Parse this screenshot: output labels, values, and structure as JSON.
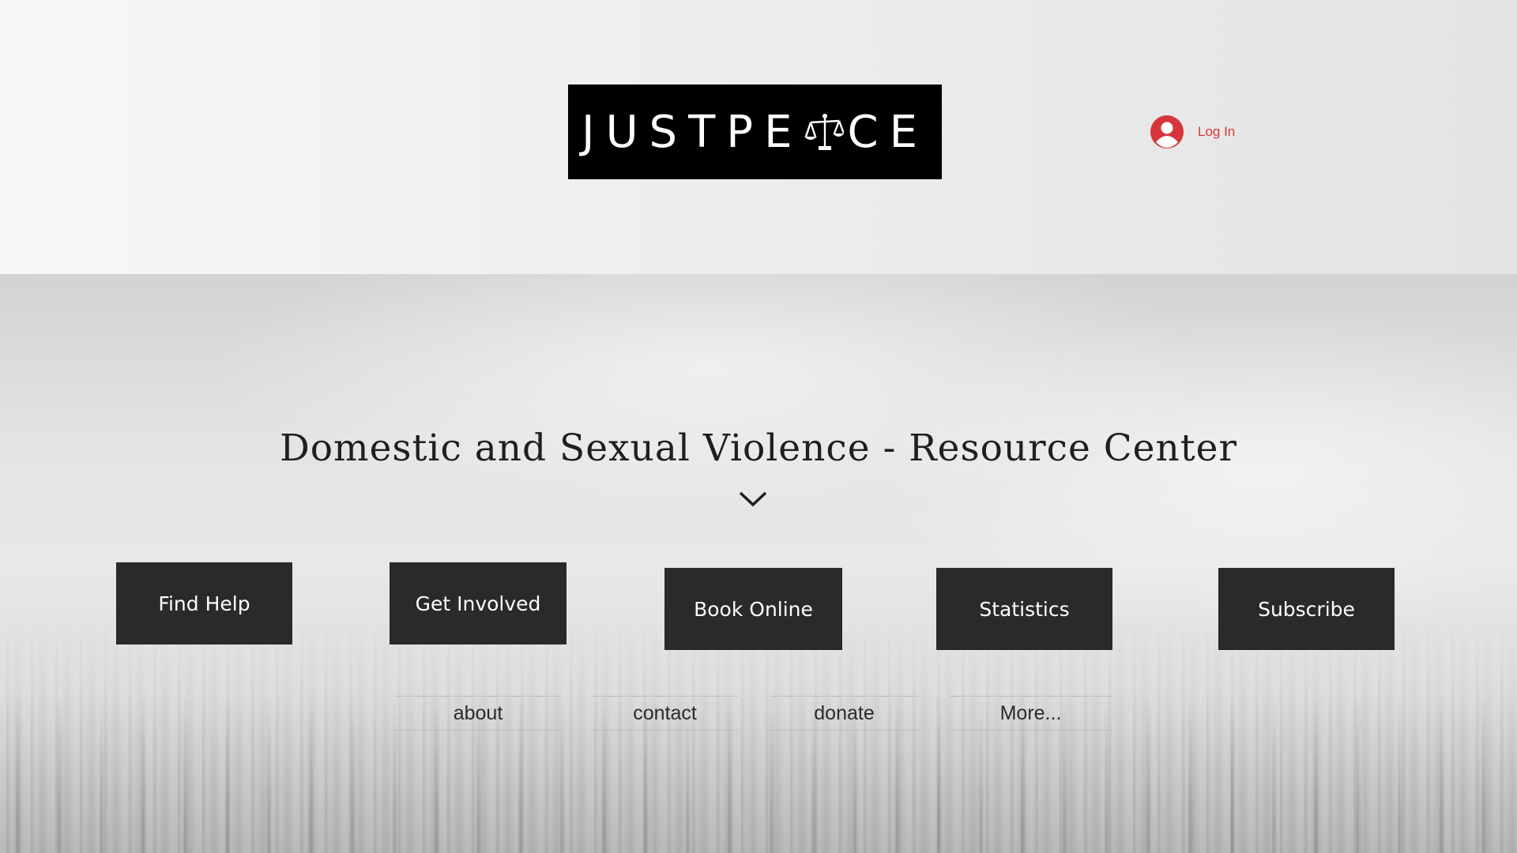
{
  "header": {
    "logo_text_left": "JUSTPE",
    "logo_text_right": "CE",
    "login_label": "Log In",
    "accent_color": "#d6363b"
  },
  "hero": {
    "title": "Domestic and Sexual Violence - Resource Center"
  },
  "buttons": {
    "find_help": "Find Help",
    "get_involved": "Get Involved",
    "book_online": "Book Online",
    "statistics": "Statistics",
    "subscribe": "Subscribe"
  },
  "nav": {
    "about": "about",
    "contact": "contact",
    "donate": "donate",
    "more": "More..."
  },
  "icons": [
    "scales-of-justice-icon",
    "user-avatar-icon",
    "chevron-down-icon"
  ]
}
